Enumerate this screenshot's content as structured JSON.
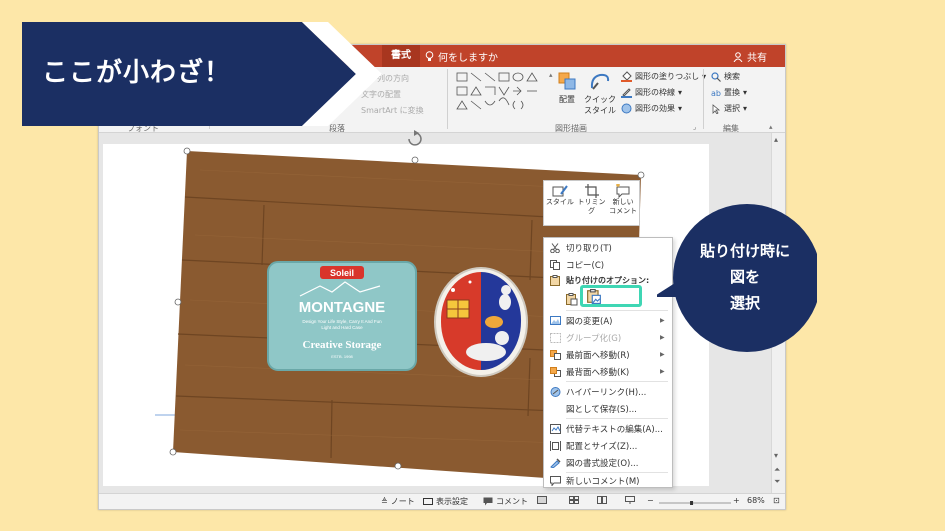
{
  "banner": {
    "text": "ここが小わざ！",
    "color": "#1b2f63"
  },
  "window": {
    "tabbar": {
      "format_tab": "書式",
      "tellme": "何をしますか",
      "share": "共有",
      "color": "#c0432a"
    },
    "ribbon": {
      "font_label": "フォント",
      "paragraph_label": "段落",
      "paragraph_items": [
        "文字列の方向",
        "文字の配置",
        "SmartArt に変換"
      ],
      "drawing_label": "図形描画",
      "arrange_button": "配置",
      "quick_style_button": "クイック\nスタイル",
      "shape_fill": "図形の塗りつぶし",
      "shape_outline": "図形の枠線",
      "shape_effects": "図形の効果",
      "edit_label": "編集",
      "find": "検索",
      "replace": "置換",
      "select": "選択"
    },
    "float_toolbar": {
      "style": "スタイル",
      "trim": "トリミング",
      "new_comment": "新しい\nコメント"
    },
    "context_menu": {
      "cut": "切り取り(T)",
      "copy": "コピー(C)",
      "paste_header": "貼り付けのオプション:",
      "change_picture": "図の変更(A)",
      "group": "グループ化(G)",
      "bring_front": "最前面へ移動(R)",
      "send_back": "最背面へ移動(K)",
      "hyperlink": "ハイパーリンク(H)...",
      "save_as_picture": "図として保存(S)...",
      "alt_text": "代替テキストの編集(A)...",
      "size_position": "配置とサイズ(Z)...",
      "format_picture": "図の書式設定(O)...",
      "new_comment": "新しいコメント(M)"
    },
    "statusbar": {
      "notes": "ノート",
      "display_settings": "表示設定",
      "comments": "コメント",
      "zoom": "68%",
      "zoom_fraction": 0.45
    }
  },
  "slide_image": {
    "tin_brand": "Soleil",
    "tin_title": "MONTAGNE",
    "tin_tagline_1": "Design Your Life Style, Carry It And Fun",
    "tin_tagline_2": "Light and Hard Case",
    "tin_product": "Creative Storage",
    "tin_est": "ESTB. 1998"
  },
  "callout": {
    "line1": "貼り付け時に",
    "line2": "図を",
    "line3": "選択",
    "color": "#1b2f63",
    "highlight_color": "#3fd6b4"
  }
}
